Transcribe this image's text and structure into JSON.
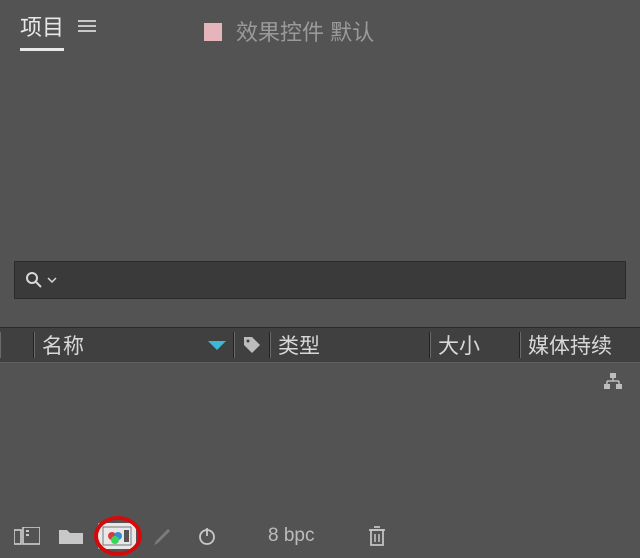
{
  "tabs": {
    "active": "项目",
    "inactive": "效果控件 默认"
  },
  "search": {
    "placeholder": ""
  },
  "columns": {
    "name": "名称",
    "type": "类型",
    "size": "大小",
    "media": "媒体持续"
  },
  "footer": {
    "bpc": "8 bpc"
  },
  "colors": {
    "swatch": "#e6b4bb",
    "highlight_ring": "#d40a0a",
    "sort_arrow": "#3fb7d6"
  }
}
